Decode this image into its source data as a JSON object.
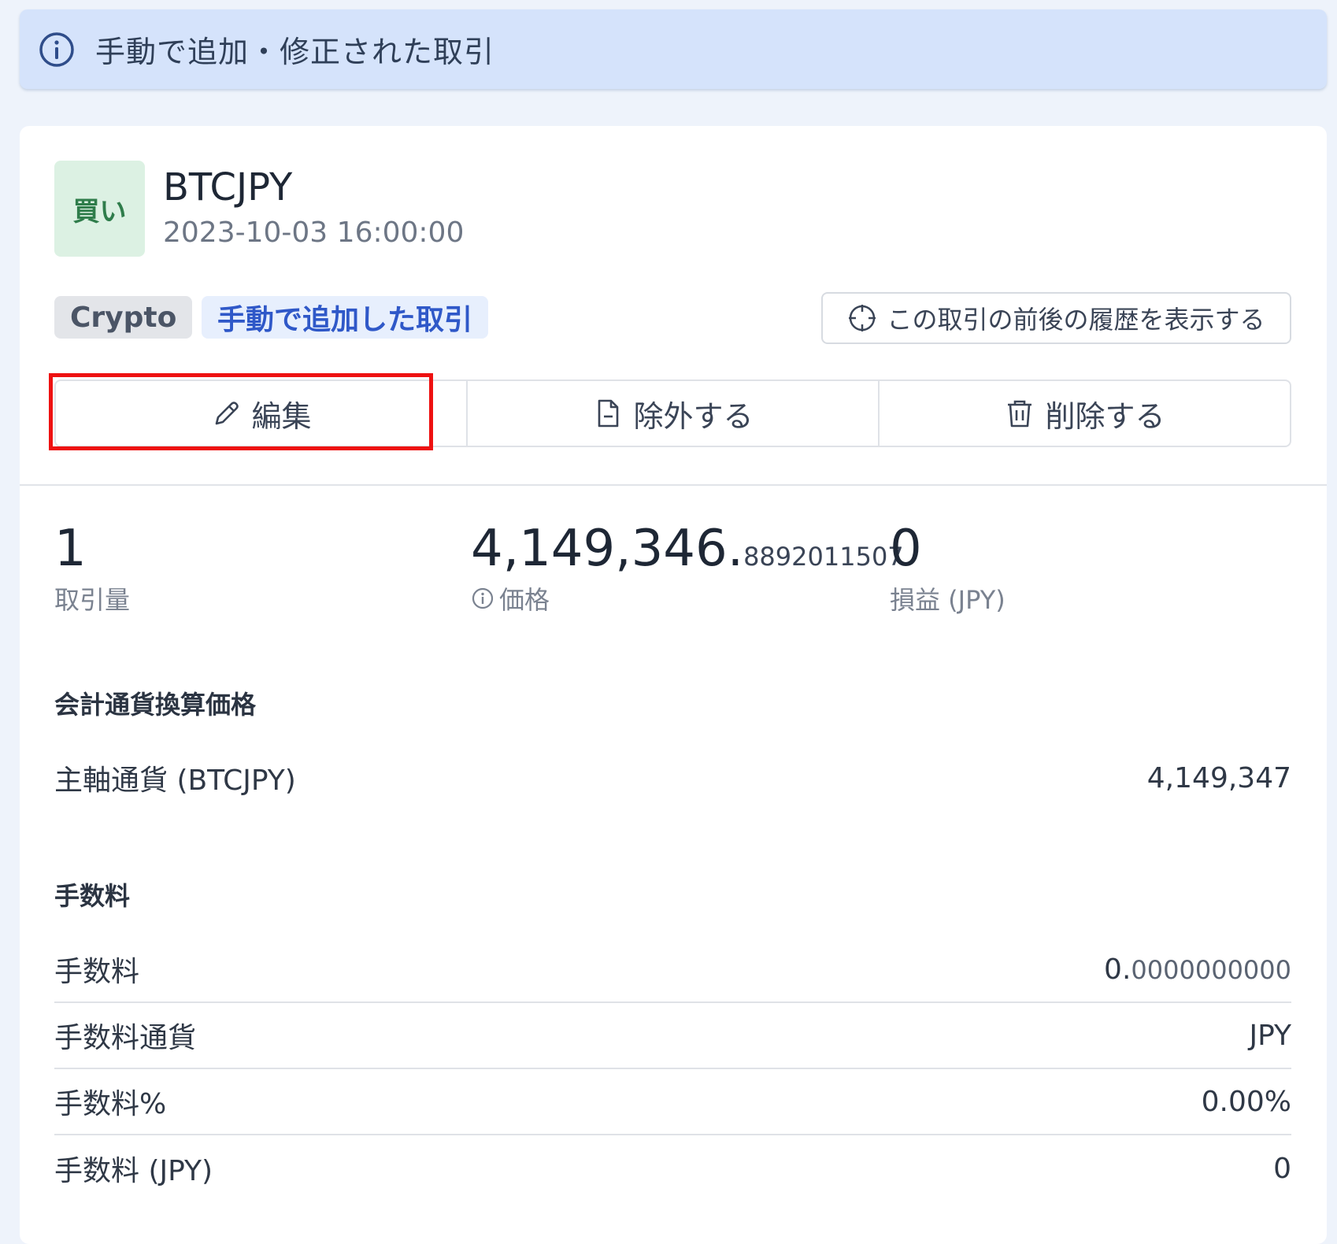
{
  "banner": {
    "text": "手動で追加・修正された取引"
  },
  "trade": {
    "side": "買い",
    "symbol": "BTCJPY",
    "datetime": "2023-10-03 16:00:00",
    "tags": {
      "category": "Crypto",
      "source": "手動で追加した取引"
    },
    "history_button": "この取引の前後の履歴を表示する",
    "actions": {
      "edit": "編集",
      "exclude": "除外する",
      "delete": "削除する"
    }
  },
  "stats": {
    "quantity": {
      "value": "1",
      "label": "取引量"
    },
    "price": {
      "int": "4,149,346.",
      "frac": "8892011507",
      "label": "価格"
    },
    "pnl": {
      "value": "0",
      "label": "損益 (JPY)"
    }
  },
  "conversion": {
    "title": "会計通貨換算価格",
    "rows": [
      {
        "label": "主軸通貨 (BTCJPY)",
        "value": "4,149,347"
      }
    ]
  },
  "fees": {
    "title": "手数料",
    "fee": {
      "label": "手数料",
      "int": "0.",
      "frac": "0000000000"
    },
    "currency": {
      "label": "手数料通貨",
      "value": "JPY"
    },
    "percent": {
      "label": "手数料%",
      "value": "0.00%"
    },
    "jpy": {
      "label": "手数料 (JPY)",
      "value": "0"
    }
  },
  "colors": {
    "banner_bg": "#d5e3fb",
    "buy_badge_bg": "#dcf1e3",
    "buy_badge_text": "#2f7d4b",
    "manual_tag_text": "#2f58c8",
    "highlight": "#ee1111"
  }
}
